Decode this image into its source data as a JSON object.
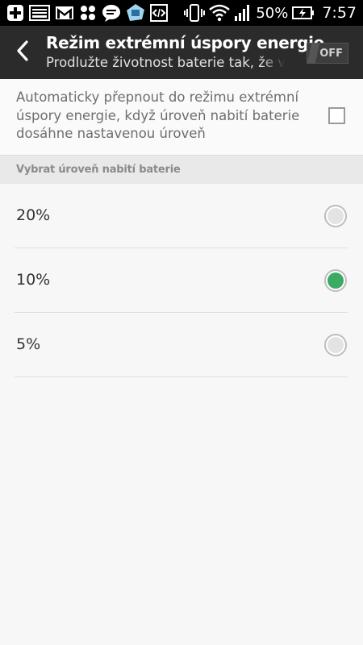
{
  "status_bar": {
    "battery_percent": "50%",
    "time": "7:57",
    "icons": [
      "plus-icon",
      "image-icon",
      "gmail-icon",
      "pinwheel-icon",
      "chat-icon",
      "app-icon",
      "code-icon",
      "vibrate-icon",
      "wifi-icon",
      "signal-icon",
      "battery-charging-icon"
    ]
  },
  "action_bar": {
    "title": "Režim extrémní úspory energie",
    "subtitle": "Prodlužte životnost baterie tak, že v",
    "toggle_label": "OFF"
  },
  "auto_switch": {
    "text": "Automaticky přepnout do režimu extrémní úspory energie, když úroveň nabití baterie dosáhne nastavenou úroveň",
    "checked": false
  },
  "section": {
    "label": "Vybrat úroveň nabití baterie"
  },
  "options": [
    {
      "label": "20%",
      "selected": false
    },
    {
      "label": "10%",
      "selected": true
    },
    {
      "label": "5%",
      "selected": false
    }
  ],
  "colors": {
    "accent": "#3daa64",
    "action_bar": "#2b2b2b",
    "status_bar": "#000000"
  }
}
